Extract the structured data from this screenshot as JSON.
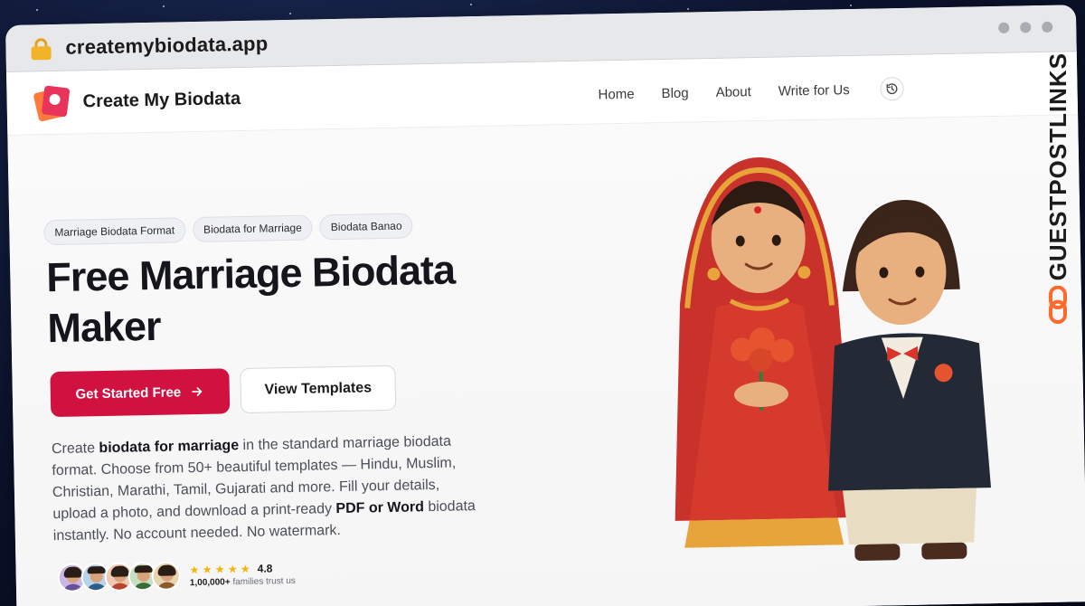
{
  "browser": {
    "url": "createmybiodata.app",
    "lock_icon": "lock-icon"
  },
  "navbar": {
    "brand": "Create My Biodata",
    "links": [
      "Home",
      "Blog",
      "About",
      "Write for Us"
    ],
    "history_icon": "history-icon"
  },
  "hero": {
    "tags": [
      "Marriage Biodata Format",
      "Biodata for Marriage",
      "Biodata Banao"
    ],
    "headline_line1": "Free Marriage Biodata",
    "headline_line2": "Maker",
    "primary_cta": "Get Started Free",
    "secondary_cta": "View Templates",
    "description": {
      "part1": "Create ",
      "bold1": "biodata for marriage",
      "part2": " in the standard marriage biodata format. Choose from 50+ beautiful templates — Hindu, Muslim, Christian, Marathi, Tamil, Gujarati and more. Fill your details, upload a photo, and download a print-ready ",
      "bold2": "PDF or Word",
      "part3": " biodata instantly. No account needed. No watermark."
    },
    "social_proof": {
      "stars": "★ ★ ★ ★ ★",
      "rating": "4.8",
      "families_count": "1,00,000+",
      "families_text": " families trust us",
      "avatar_count": 5
    }
  },
  "watermark": {
    "text": "GUESTPOSTLINKS",
    "icon": "chain-link-icon"
  },
  "colors": {
    "primary": "#d11240",
    "star": "#f4b400",
    "background_space": "#0c1430"
  }
}
